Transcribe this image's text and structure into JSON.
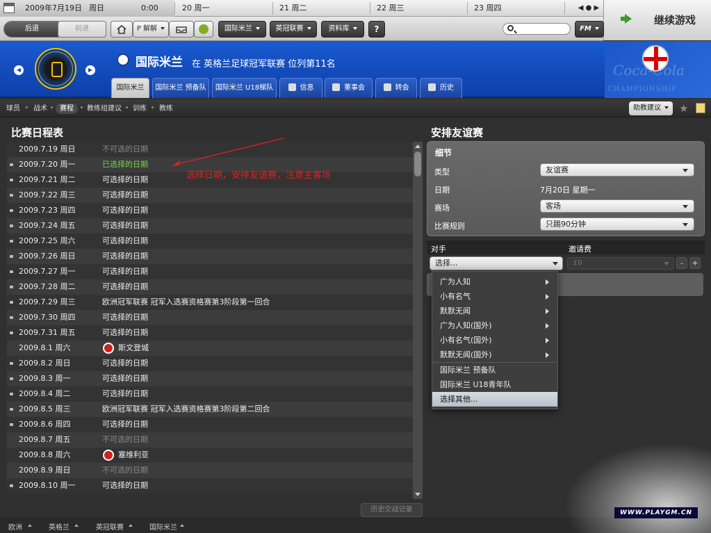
{
  "datebar": {
    "current_date": "2009年7月19日",
    "current_day": "周日",
    "time": "0:00",
    "days": [
      "20 周一",
      "21 周二",
      "22 周三",
      "23 周四"
    ]
  },
  "continue_label": "继续游戏",
  "toolbar": {
    "back": "后退",
    "forward": "前进",
    "p_label": "P 解解",
    "menus": [
      "国际米兰",
      "英冠联赛",
      "资料库"
    ],
    "help": "?",
    "fm": "FM"
  },
  "club": {
    "name": "国际米兰",
    "subtitle": "在 英格兰足球冠军联赛 位列第11名"
  },
  "sponsor": {
    "text1": "Coca-Cola",
    "text2": "CHAMPIONSHIP"
  },
  "tabs": [
    "国际米兰",
    "国际米兰 预备队",
    "国际米兰 U18梯队",
    "信息",
    "董事会",
    "转会",
    "历史"
  ],
  "subnav": [
    "球员",
    "战术",
    "赛程",
    "教练组建议",
    "训练",
    "教练"
  ],
  "assist_label": "助教建议",
  "schedule": {
    "title": "比赛日程表",
    "rows": [
      {
        "date": "2009.7.19 周日",
        "status": "不可选的日期",
        "kind": "dim",
        "marker": false
      },
      {
        "date": "2009.7.20 周一",
        "status": "已选择的日期",
        "kind": "sel",
        "marker": true
      },
      {
        "date": "2009.7.21 周二",
        "status": "可选择的日期",
        "kind": "",
        "marker": true
      },
      {
        "date": "2009.7.22 周三",
        "status": "可选择的日期",
        "kind": "",
        "marker": true
      },
      {
        "date": "2009.7.23 周四",
        "status": "可选择的日期",
        "kind": "",
        "marker": true
      },
      {
        "date": "2009.7.24 周五",
        "status": "可选择的日期",
        "kind": "",
        "marker": true
      },
      {
        "date": "2009.7.25 周六",
        "status": "可选择的日期",
        "kind": "",
        "marker": true
      },
      {
        "date": "2009.7.26 周日",
        "status": "可选择的日期",
        "kind": "",
        "marker": true
      },
      {
        "date": "2009.7.27 周一",
        "status": "可选择的日期",
        "kind": "",
        "marker": true
      },
      {
        "date": "2009.7.28 周二",
        "status": "可选择的日期",
        "kind": "",
        "marker": true
      },
      {
        "date": "2009.7.29 周三",
        "status": "欧洲冠军联赛 冠军入选赛资格赛第3阶段第一回合",
        "kind": "",
        "marker": true
      },
      {
        "date": "2009.7.30 周四",
        "status": "可选择的日期",
        "kind": "",
        "marker": true
      },
      {
        "date": "2009.7.31 周五",
        "status": "可选择的日期",
        "kind": "",
        "marker": true
      },
      {
        "date": "2009.8.1 周六",
        "status": "斯文登城",
        "kind": "team",
        "marker": false
      },
      {
        "date": "2009.8.2 周日",
        "status": "可选择的日期",
        "kind": "",
        "marker": true
      },
      {
        "date": "2009.8.3 周一",
        "status": "可选择的日期",
        "kind": "",
        "marker": true
      },
      {
        "date": "2009.8.4 周二",
        "status": "可选择的日期",
        "kind": "",
        "marker": true
      },
      {
        "date": "2009.8.5 周三",
        "status": "欧洲冠军联赛 冠军入选赛资格赛第3阶段第二回合",
        "kind": "",
        "marker": true
      },
      {
        "date": "2009.8.6 周四",
        "status": "可选择的日期",
        "kind": "",
        "marker": true
      },
      {
        "date": "2009.8.7 周五",
        "status": "不可选的日期",
        "kind": "dim",
        "marker": false
      },
      {
        "date": "2009.8.8 周六",
        "status": "塞维利亚",
        "kind": "team",
        "marker": false
      },
      {
        "date": "2009.8.9 周日",
        "status": "不可选的日期",
        "kind": "dim",
        "marker": false
      },
      {
        "date": "2009.8.10 周一",
        "status": "可选择的日期",
        "kind": "",
        "marker": true
      }
    ],
    "annotation": "选择日期，安排友谊赛，注意主客场",
    "history_button": "历史交战记录"
  },
  "friendly": {
    "title": "安排友谊赛",
    "details_title": "细节",
    "type_label": "类型",
    "type_value": "友谊赛",
    "date_label": "日期",
    "date_value": "7月20日 星期一",
    "venue_label": "赛场",
    "venue_value": "客场",
    "rules_label": "比赛规则",
    "rules_value": "只踢90分钟",
    "opponent_label": "对手",
    "opponent_value": "选择...",
    "fee_label": "邀请费",
    "fee_value": "£0",
    "minus": "-",
    "plus": "+"
  },
  "menu": {
    "items": [
      {
        "label": "广为人知",
        "sub": true
      },
      {
        "label": "小有名气",
        "sub": true
      },
      {
        "label": "默默无闻",
        "sub": true
      },
      {
        "label": "广为人知(国外)",
        "sub": true
      },
      {
        "label": "小有名气(国外)",
        "sub": true
      },
      {
        "label": "默默无闻(国外)",
        "sub": true
      },
      {
        "label": "国际米兰 预备队",
        "sub": false
      },
      {
        "label": "国际米兰 U18青年队",
        "sub": false
      },
      {
        "label": "选择其他...",
        "sub": false,
        "highlight": true
      }
    ]
  },
  "breadcrumbs": [
    "欧洲",
    "英格兰",
    "英冠联赛",
    "国际米兰"
  ],
  "brand": "WWW.PLAYGM.CN"
}
